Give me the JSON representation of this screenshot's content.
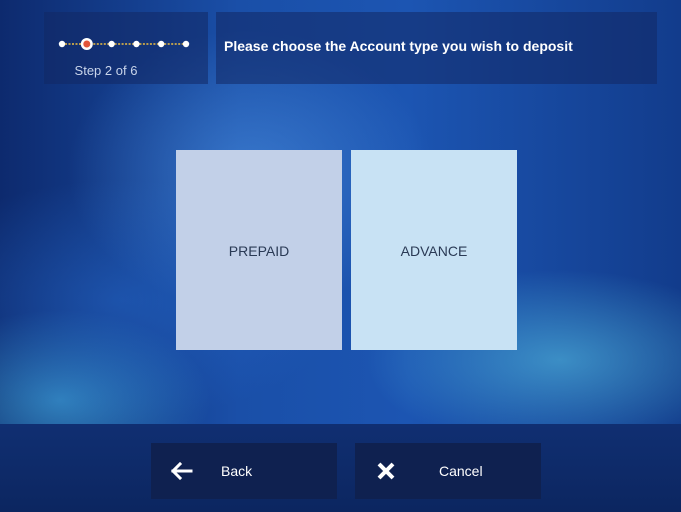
{
  "header": {
    "step": {
      "label": "Step 2 of 6",
      "total": 6,
      "current": 2
    },
    "title": "Please choose the Account type you wish to deposit"
  },
  "options": [
    {
      "label": "PREPAID"
    },
    {
      "label": "ADVANCE"
    }
  ],
  "footer": {
    "back_label": "Back",
    "back_icon": "arrow-left-icon",
    "cancel_label": "Cancel",
    "cancel_icon": "close-icon"
  },
  "colors": {
    "current_step": "#e2553a",
    "step_dot": "#ffffff",
    "step_connector": "#f0c040"
  }
}
